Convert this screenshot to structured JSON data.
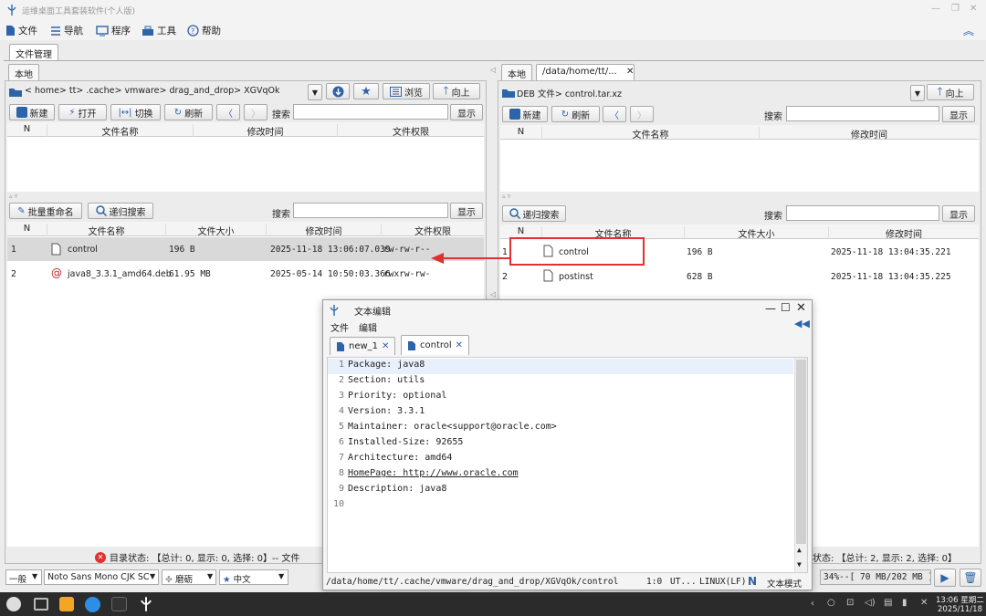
{
  "window": {
    "title": "运维桌面工具套装软件(个人版)"
  },
  "menu": [
    {
      "name": "menu-file",
      "label": "文件",
      "icon": "file-icon"
    },
    {
      "name": "menu-nav",
      "label": "导航",
      "icon": "menu-icon"
    },
    {
      "name": "menu-programs",
      "label": "程序",
      "icon": "monitor-icon"
    },
    {
      "name": "menu-tools",
      "label": "工具",
      "icon": "toolbox-icon"
    },
    {
      "name": "menu-help",
      "label": "帮助",
      "icon": "help-icon"
    }
  ],
  "main_tab": "文件管理",
  "left": {
    "tab": "本地",
    "path": "< home> tt> .cache> vmware> drag_and_drop> XGVqOk",
    "browse_label": "浏览",
    "up_label": "向上",
    "new_label": "新建",
    "open_label": "打开",
    "switch_label": "切换",
    "refresh_label": "刷新",
    "search_label": "搜索",
    "show_label": "显示",
    "top_headers": [
      "N",
      "文件名称",
      "修改时间",
      "文件权限"
    ],
    "rename_label": "批量重命名",
    "recursive_label": "递归搜索",
    "bottom_headers": [
      "N",
      "文件名称",
      "文件大小",
      "修改时间",
      "文件权限"
    ],
    "rows": [
      {
        "n": "1",
        "name": "control",
        "size": "196 B",
        "mtime": "2025-11-18 13:06:07.039",
        "perm": "rw-rw-r--"
      },
      {
        "n": "2",
        "name": "java8_3.3.1_amd64.deb",
        "size": "61.95 MB",
        "mtime": "2025-05-14 10:50:03.366",
        "perm": "rwxrw-rw-"
      }
    ],
    "status": "目录状态: 【总计: 0, 显示: 0, 选择: 0】-- 文件"
  },
  "right": {
    "tab_local": "本地",
    "tab_path": "/data/home/tt/...",
    "path": "DEB 文件> control.tar.xz",
    "up_label": "向上",
    "new_label": "新建",
    "refresh_label": "刷新",
    "search_label": "搜索",
    "show_label": "显示",
    "top_headers": [
      "N",
      "文件名称",
      "修改时间"
    ],
    "recursive_label": "递归搜索",
    "bottom_headers": [
      "N",
      "文件名称",
      "文件大小",
      "修改时间"
    ],
    "rows": [
      {
        "n": "1",
        "name": "control",
        "size": "196 B",
        "mtime": "2025-11-18 13:04:35.221"
      },
      {
        "n": "2",
        "name": "postinst",
        "size": "628 B",
        "mtime": "2025-11-18 13:04:35.225"
      }
    ],
    "status": "状态: 【总计: 2, 显示: 2, 选择: 0】"
  },
  "editor": {
    "title": "文本编辑",
    "menu_file": "文件",
    "menu_edit": "编辑",
    "tabs": [
      "new_1",
      "control"
    ],
    "lines": [
      "Package: java8",
      "Section: utils",
      "Priority: optional",
      "Version: 3.3.1",
      "Maintainer: oracle<support@oracle.com>",
      "Installed-Size: 92655",
      "Architecture: amd64",
      "HomePage: http://www.oracle.com",
      "Description: java8",
      ""
    ],
    "path": "/data/home/tt/.cache/vmware/drag_and_drop/XGVqOk/control",
    "position": "1:0",
    "encoding": "UT...",
    "eol": "LINUX(LF)",
    "mode": "文本模式"
  },
  "bottom_bar": {
    "mode": "一般",
    "font": "Noto Sans Mono CJK SC",
    "theme": "磨砺",
    "lang": "中文",
    "memory": "34%--[ 70 MB/202 MB ]"
  },
  "taskbar": {
    "time": "13:06 星期二",
    "date": "2025/11/18"
  },
  "colors": {
    "accent": "#2d63a8",
    "highlight": "#e03030",
    "selected_row": "#d9d9d9"
  }
}
